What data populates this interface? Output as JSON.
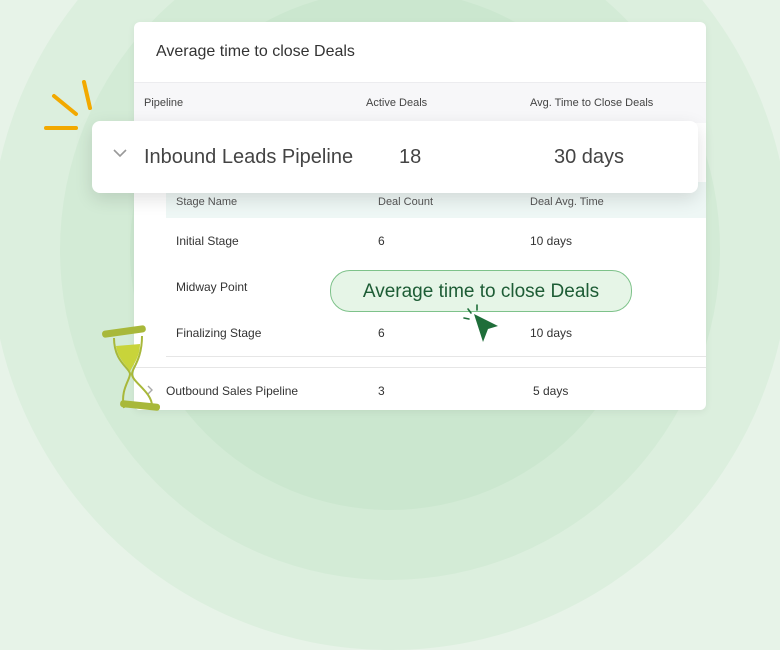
{
  "card": {
    "title": "Average time to close Deals",
    "columns": [
      "Pipeline",
      "Active Deals",
      "Avg. Time to Close Deals"
    ]
  },
  "highlight_row": {
    "pipeline": "Inbound Leads Pipeline",
    "active_deals": "18",
    "avg_time": "30 days"
  },
  "sub_table": {
    "columns": [
      "Stage Name",
      "Deal Count",
      "Deal Avg. Time"
    ],
    "rows": [
      {
        "stage": "Initial Stage",
        "count": "6",
        "time": "10 days"
      },
      {
        "stage": "Midway Point",
        "count": "",
        "time": ""
      },
      {
        "stage": "Finalizing Stage",
        "count": "6",
        "time": "10 days"
      }
    ]
  },
  "outbound_row": {
    "pipeline": "Outbound Sales Pipeline",
    "active_deals": "3",
    "avg_time": "5 days"
  },
  "tooltip": {
    "label": "Average time to close Deals"
  },
  "colors": {
    "accent": "#1f6e3a",
    "tooltip_bg": "#e6f5e7",
    "spark": "#f2a900",
    "hourglass": "#a8b83a"
  },
  "icons": [
    "chevron-down-icon",
    "chevron-right-icon",
    "cursor-icon",
    "sparkle-icon",
    "hourglass-icon"
  ]
}
